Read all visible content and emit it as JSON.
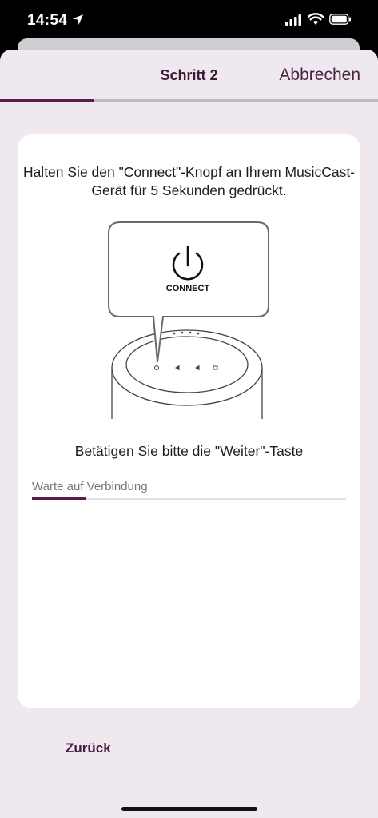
{
  "status_bar": {
    "time": "14:54",
    "icons": [
      "location-arrow-icon",
      "cellular-signal-icon",
      "wifi-icon",
      "battery-icon"
    ]
  },
  "nav": {
    "title": "Schritt 2",
    "cancel_label": "Abbrechen",
    "step_progress": 0.25
  },
  "card": {
    "instruction": "Halten Sie den \"Connect\"-Knopf an Ihrem MusicCast-Gerät für 5 Sekunden gedrückt.",
    "button_label": "CONNECT",
    "press_text": "Betätigen Sie bitte die \"Weiter\"-Taste",
    "waiting_label": "Warte auf Verbindung",
    "connection_progress": 0.17
  },
  "footer": {
    "back_label": "Zurück"
  },
  "colors": {
    "accent": "#5b1f4e",
    "sheet_background": "#efe8ee",
    "card_background": "#ffffff"
  }
}
